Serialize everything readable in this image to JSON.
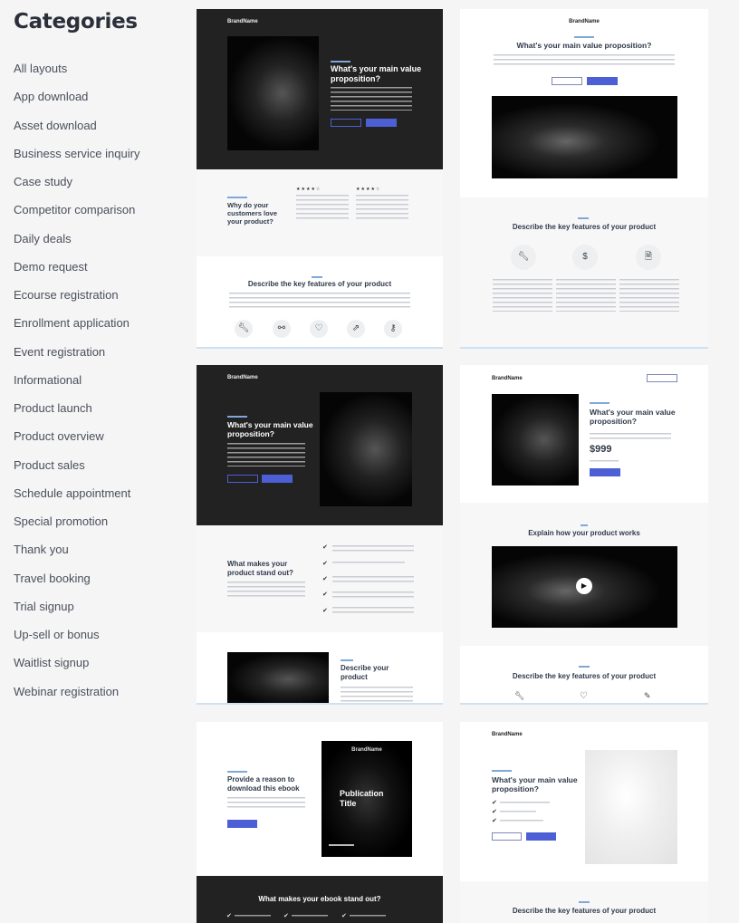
{
  "sidebar": {
    "title": "Categories",
    "items": [
      "All layouts",
      "App download",
      "Asset download",
      "Business service inquiry",
      "Case study",
      "Competitor comparison",
      "Daily deals",
      "Demo request",
      "Ecourse registration",
      "Enrollment application",
      "Event registration",
      "Informational",
      "Product launch",
      "Product overview",
      "Product sales",
      "Schedule appointment",
      "Special promotion",
      "Thank you",
      "Travel booking",
      "Trial signup",
      "Up-sell or bonus",
      "Waitlist signup",
      "Webinar registration"
    ]
  },
  "templates": {
    "t1": {
      "brand": "BrandName",
      "hero": "What's your main value proposition?",
      "reviews": "Why do your customers love your product?",
      "features": "Describe the key features of your product",
      "stars": "★★★★☆"
    },
    "t2": {
      "brand": "BrandName",
      "hero": "What's your main value proposition?",
      "features": "Describe the key features of your product"
    },
    "t3": {
      "brand": "BrandName",
      "hero": "What's your main value proposition?",
      "standout": "What makes your product stand out?",
      "describe": "Describe your product"
    },
    "t4": {
      "brand": "BrandName",
      "hero": "What's your main value proposition?",
      "price": "$999",
      "how": "Explain how your product works",
      "features": "Describe the key features of your product"
    },
    "t5": {
      "hero": "Provide a reason to download this ebook",
      "cover_brand": "BrandName",
      "cover_title": "Publication Title",
      "standout": "What makes your ebook stand out?"
    },
    "t6": {
      "brand": "BrandName",
      "hero": "What's your main value proposition?",
      "features": "Describe the key features of your product"
    }
  },
  "colors": {
    "accent": "#4c5fd5",
    "dark": "#222222",
    "eyebrow": "#7fa8d8"
  },
  "icons": [
    "wrench-icon",
    "link-icon",
    "heart-icon",
    "external-link-icon",
    "key-icon",
    "dollar-icon",
    "document-icon",
    "play-icon",
    "pen-icon",
    "check-icon"
  ]
}
